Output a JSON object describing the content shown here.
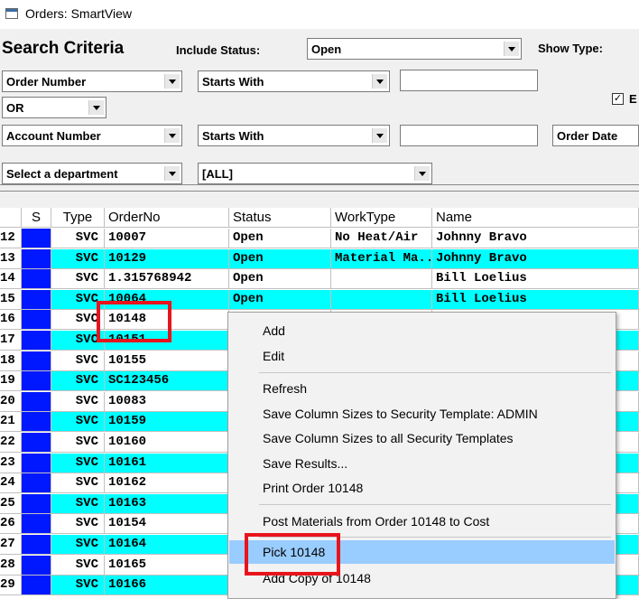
{
  "window": {
    "title": "Orders: SmartView"
  },
  "search": {
    "heading": "Search Criteria",
    "include_status_label": "Include Status:",
    "include_status_value": "Open",
    "show_type_label": "Show Type:",
    "field1": "Order Number",
    "op1": "Starts With",
    "value1": "",
    "logic": "OR",
    "field2": "Account Number",
    "op2": "Starts With",
    "value2": "",
    "date_field": "Order Date",
    "dept": "Select a department",
    "dept_value": "[ALL]",
    "checkbox_label": "E",
    "checkbox_checked": "✓"
  },
  "grid": {
    "columns": [
      "S",
      "Type",
      "OrderNo",
      "Status",
      "WorkType",
      "Name"
    ],
    "rows": [
      {
        "num": "12",
        "type": "SVC",
        "order": "10007",
        "status": "Open",
        "work": "No Heat/Air",
        "name": "Johnny Bravo",
        "bg": "white"
      },
      {
        "num": "13",
        "type": "SVC",
        "order": "10129",
        "status": "Open",
        "work": "Material Ma...",
        "name": "Johnny Bravo",
        "bg": "cyan"
      },
      {
        "num": "14",
        "type": "SVC",
        "order": "1.315768942",
        "status": "Open",
        "work": "",
        "name": "Bill Loelius",
        "bg": "white"
      },
      {
        "num": "15",
        "type": "SVC",
        "order": "10064",
        "status": "Open",
        "work": "",
        "name": "Bill Loelius",
        "bg": "cyan"
      },
      {
        "num": "16",
        "type": "SVC",
        "order": "10148",
        "status": "",
        "work": "",
        "name": "",
        "bg": "white"
      },
      {
        "num": "17",
        "type": "SVC",
        "order": "10151",
        "status": "",
        "work": "",
        "name": "",
        "bg": "cyan"
      },
      {
        "num": "18",
        "type": "SVC",
        "order": "10155",
        "status": "",
        "work": "",
        "name": "",
        "bg": "white"
      },
      {
        "num": "19",
        "type": "SVC",
        "order": "SC123456",
        "status": "",
        "work": "",
        "name": "",
        "bg": "cyan"
      },
      {
        "num": "20",
        "type": "SVC",
        "order": "10083",
        "status": "",
        "work": "",
        "name": "",
        "bg": "white"
      },
      {
        "num": "21",
        "type": "SVC",
        "order": "10159",
        "status": "",
        "work": "",
        "name": "",
        "bg": "cyan"
      },
      {
        "num": "22",
        "type": "SVC",
        "order": "10160",
        "status": "",
        "work": "",
        "name": "",
        "bg": "white"
      },
      {
        "num": "23",
        "type": "SVC",
        "order": "10161",
        "status": "",
        "work": "",
        "name": "",
        "bg": "cyan"
      },
      {
        "num": "24",
        "type": "SVC",
        "order": "10162",
        "status": "",
        "work": "",
        "name": "",
        "bg": "white"
      },
      {
        "num": "25",
        "type": "SVC",
        "order": "10163",
        "status": "",
        "work": "",
        "name": "",
        "bg": "cyan"
      },
      {
        "num": "26",
        "type": "SVC",
        "order": "10154",
        "status": "",
        "work": "",
        "name": "",
        "bg": "white"
      },
      {
        "num": "27",
        "type": "SVC",
        "order": "10164",
        "status": "",
        "work": "",
        "name": "",
        "bg": "cyan"
      },
      {
        "num": "28",
        "type": "SVC",
        "order": "10165",
        "status": "",
        "work": "",
        "name": "",
        "bg": "white"
      },
      {
        "num": "29",
        "type": "SVC",
        "order": "10166",
        "status": "",
        "work": "",
        "name": "",
        "bg": "cyan"
      }
    ]
  },
  "context_menu": {
    "items": [
      "Add",
      "Edit",
      "Refresh",
      "Save Column Sizes to Security Template: ADMIN",
      "Save Column Sizes to all Security Templates",
      "Save Results...",
      "Print Order 10148",
      "Post Materials from Order 10148 to Cost",
      "Pick 10148",
      "Add Copy of 10148"
    ],
    "highlighted": "Pick 10148"
  },
  "colors": {
    "status_blue": "#0018ff",
    "alt_row": "#00ffff",
    "highlight": "#99ccff",
    "callout_red": "#e8141c"
  }
}
